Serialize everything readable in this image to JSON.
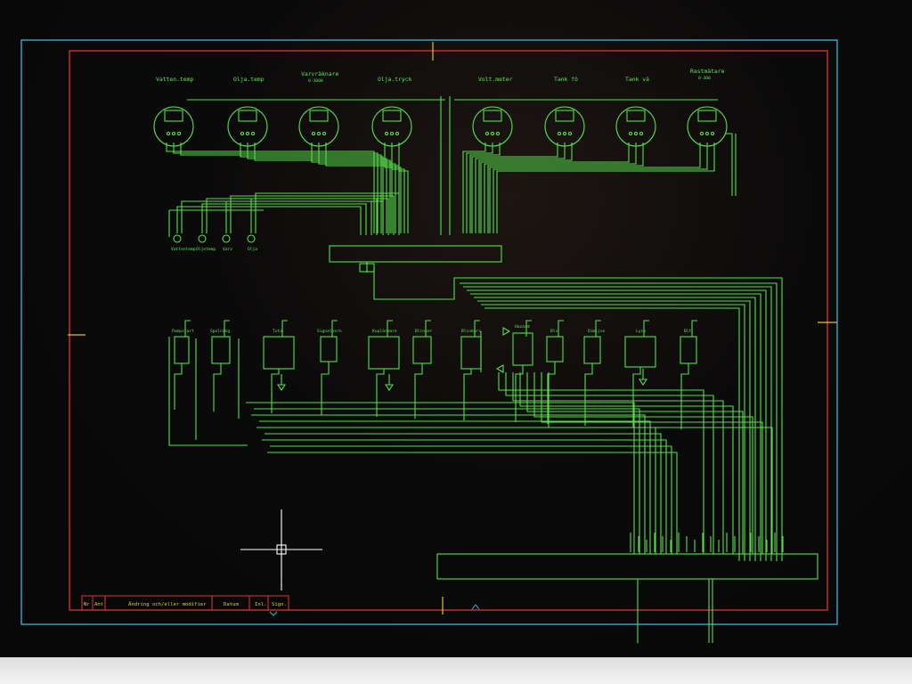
{
  "gauges": [
    {
      "label": "Vatten.temp"
    },
    {
      "label": "Olja.temp"
    },
    {
      "label": "Varvräknare",
      "sub": "0-3000"
    },
    {
      "label": "Olja.tryck"
    },
    {
      "label": "Volt.meter"
    },
    {
      "label": "Tank fö"
    },
    {
      "label": "Tank vä"
    },
    {
      "label": "Rastmätare",
      "sub": "0-300"
    }
  ],
  "senders": [
    {
      "label": "Vattentemp"
    },
    {
      "label": "Oljetemp"
    },
    {
      "label": "Varv"
    },
    {
      "label": "Olja"
    }
  ],
  "switches": [
    {
      "label": "Pumpstart"
    },
    {
      "label": "Spolning"
    },
    {
      "label": "Tuta"
    },
    {
      "label": "Signalhorn"
    },
    {
      "label": "Kuplärmare"
    },
    {
      "label": "Blinker"
    },
    {
      "label": "Blinkers"
    },
    {
      "label": "Hazard"
    },
    {
      "label": "Blv"
    },
    {
      "label": "Dimljus"
    },
    {
      "label": "Lyse"
    },
    {
      "label": "Blt"
    }
  ],
  "title_block": {
    "nr": "Nr",
    "ant": "Ant",
    "description": "Ändring och/eller modifier",
    "date": "Datum",
    "initials": "Inl.",
    "sign": "Sign."
  },
  "colors": {
    "background": "#070707",
    "wires": "#56e04a",
    "outer_border": "#35b8d8",
    "inner_border": "#e03434",
    "markers": "#e8c020",
    "cursor": "#ffffff"
  }
}
